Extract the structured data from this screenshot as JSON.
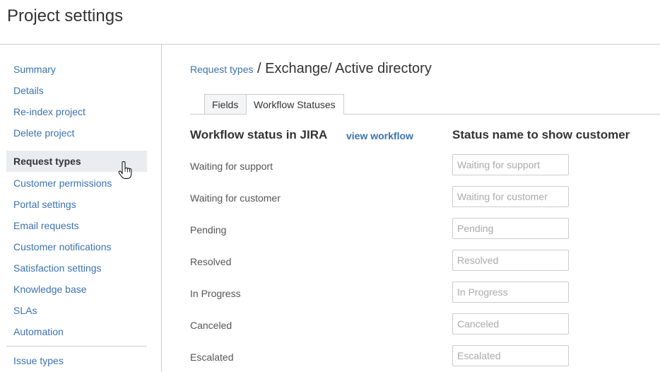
{
  "page": {
    "title": "Project settings"
  },
  "sidebar": {
    "items": [
      {
        "label": "Summary"
      },
      {
        "label": "Details"
      },
      {
        "label": "Re-index project"
      },
      {
        "label": "Delete project"
      },
      {
        "label": "Request types",
        "selected": true
      },
      {
        "label": "Customer permissions"
      },
      {
        "label": "Portal settings"
      },
      {
        "label": "Email requests"
      },
      {
        "label": "Customer notifications"
      },
      {
        "label": "Satisfaction settings"
      },
      {
        "label": "Knowledge base"
      },
      {
        "label": "SLAs"
      },
      {
        "label": "Automation"
      },
      {
        "label": "Issue types"
      }
    ]
  },
  "breadcrumb": {
    "link": "Request types",
    "current": " / Exchange/ Active directory"
  },
  "tabs": [
    {
      "label": "Fields"
    },
    {
      "label": "Workflow Statuses",
      "active": true
    }
  ],
  "table": {
    "col1_header": "Workflow status in JIRA",
    "view_workflow": "view workflow",
    "col2_header": "Status name to show customer",
    "rows": [
      {
        "status": "Waiting for support",
        "placeholder": "Waiting for support"
      },
      {
        "status": "Waiting for customer",
        "placeholder": "Waiting for customer"
      },
      {
        "status": "Pending",
        "placeholder": "Pending"
      },
      {
        "status": "Resolved",
        "placeholder": "Resolved"
      },
      {
        "status": "In Progress",
        "placeholder": "In Progress"
      },
      {
        "status": "Canceled",
        "placeholder": "Canceled"
      },
      {
        "status": "Escalated",
        "placeholder": "Escalated"
      }
    ]
  },
  "colors": {
    "link": "#3b73af",
    "text": "#333333",
    "border": "#cccccc",
    "selected_bg": "#ebecf0"
  }
}
